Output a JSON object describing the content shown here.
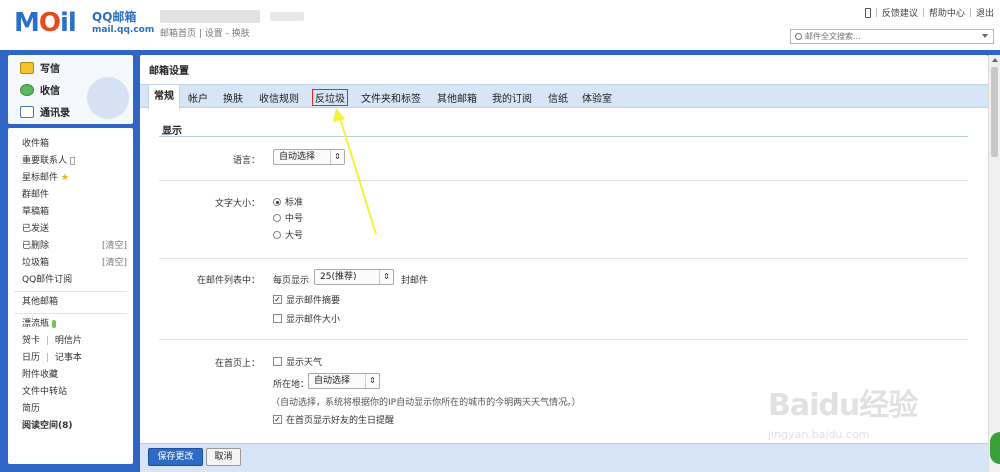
{
  "header": {
    "logo_main_m": "M",
    "logo_main_o": "O",
    "logo_main_il": "il",
    "logo_title": "QQ邮箱",
    "logo_url": "mail.qq.com",
    "nav_links": "邮箱首页 | 设置 - 换肤",
    "top_links": {
      "feedback": "反馈建议",
      "help": "帮助中心",
      "logout": "退出",
      "sep": "|"
    },
    "search_placeholder": "邮件全文搜索..."
  },
  "sidebar": {
    "actions": [
      {
        "label": "写信",
        "icon": "pencil-icon"
      },
      {
        "label": "收信",
        "icon": "inbox-icon"
      },
      {
        "label": "通讯录",
        "icon": "contacts-icon"
      }
    ],
    "folders": {
      "inbox": "收件箱",
      "vip": "重要联系人",
      "starred": "星标邮件",
      "group": "群邮件",
      "drafts": "草稿箱",
      "sent": "已发送",
      "deleted": "已删除",
      "deleted_clear": "[清空]",
      "spam": "垃圾箱",
      "spam_clear": "[清空]",
      "qq_subscribe": "QQ邮件订阅",
      "other_mailbox": "其他邮箱",
      "drift_bottle": "漂流瓶",
      "greeting_card": "贺卡",
      "postcard": "明信片",
      "calendar": "日历",
      "notebook": "记事本",
      "attachments": "附件收藏",
      "file_transfer": "文件中转站",
      "resume": "简历",
      "reading_space": "阅读空间(8)",
      "pipe": "|"
    }
  },
  "main": {
    "title": "邮箱设置",
    "tabs": [
      "常规",
      "帐户",
      "换肤",
      "收信规则",
      "反垃圾",
      "文件夹和标签",
      "其他邮箱",
      "我的订阅",
      "信纸",
      "体验室"
    ],
    "section_title": "显示",
    "language": {
      "label": "语言：",
      "value": "自动选择"
    },
    "font_size": {
      "label": "文字大小：",
      "options": [
        "标准",
        "中号",
        "大号"
      ],
      "selected": "标准"
    },
    "mail_list": {
      "label": "在邮件列表中：",
      "per_page_prefix": "每页显示",
      "per_page_value": "25(推荐)",
      "per_page_suffix": "封邮件",
      "show_summary": "显示邮件摘要",
      "show_summary_checked": true,
      "show_size": "显示邮件大小",
      "show_size_checked": false
    },
    "homepage": {
      "label": "在首页上：",
      "show_weather": "显示天气",
      "show_weather_checked": false,
      "location_label": "所在地：",
      "location_value": "自动选择",
      "location_note": "（自动选择，系统将根据你的IP自动显示你所在的城市的今明两天天气情况。）",
      "show_birthday": "在首页显示好友的生日提醒",
      "show_birthday_checked": true
    },
    "buttons": {
      "save": "保存更改",
      "cancel": "取消"
    }
  },
  "watermark": {
    "main": "Baidu经验",
    "sub": "jingyan.baidu.com"
  },
  "colors": {
    "frame_blue": "#2f66c6",
    "tab_bar": "#d7e5f6",
    "annotation_arrow": "#f5f03a",
    "highlight_box": "#e02a2a"
  }
}
